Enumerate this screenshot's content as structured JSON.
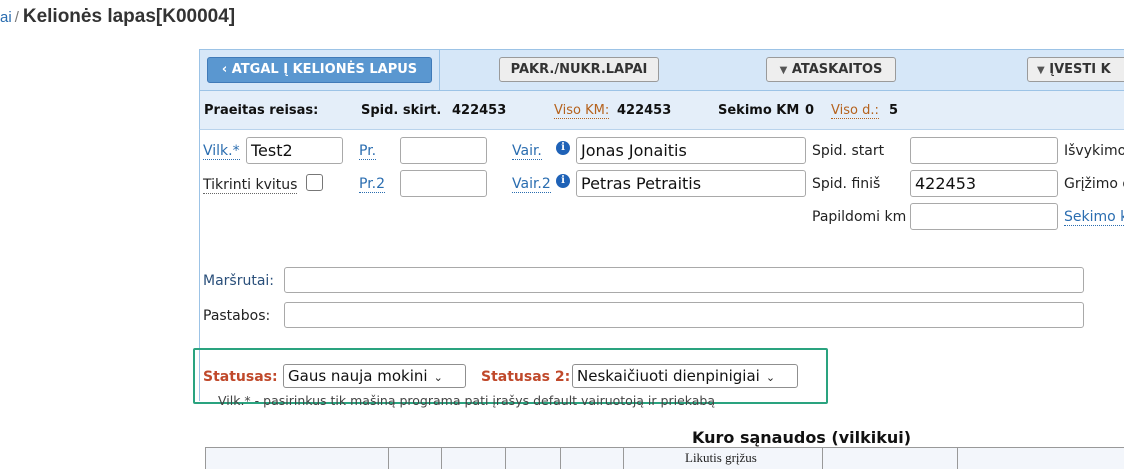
{
  "breadcrumb": {
    "prev": "ai",
    "separator": "/",
    "title": "Kelionės lapas[K00004]"
  },
  "toolbar": {
    "back_label": "ATGAL Į KELIONĖS LAPUS",
    "back_glyph": "‹",
    "load_label": "PAKR./NUKR.LAPAI",
    "reports_label": "ATASKAITOS",
    "enter_label": "ĮVESTI K",
    "dropdown_glyph": "▼"
  },
  "info": {
    "prev_trip_label": "Praeitas reisas:",
    "spid_diff_label": "Spid. skirt.",
    "spid_diff_value": "422453",
    "total_km_label": "Viso KM:",
    "total_km_value": "422453",
    "tracking_km_label": "Sekimo KM",
    "tracking_km_value": "0",
    "total_days_label": "Viso d.:",
    "total_days_value": "5"
  },
  "form": {
    "truck_label": "Vilk.*",
    "truck_value": "Test2",
    "check_receipts_label": "Tikrinti kvitus",
    "trailer1_label": "Pr.",
    "trailer1_value": "",
    "trailer2_label": "Pr.2",
    "trailer2_value": "",
    "driver1_label": "Vair.",
    "driver1_value": "Jonas Jonaitis",
    "driver2_label": "Vair.2",
    "driver2_value": "Petras Petraitis",
    "info_glyph": "i",
    "spid_start_label": "Spid. start",
    "spid_start_value": "",
    "spid_finish_label": "Spid. finiš",
    "spid_finish_value": "422453",
    "extra_km_label": "Papildomi km",
    "extra_km_value": "",
    "departure_label": "Išvykimo",
    "return_label": "Grįžimo d",
    "tracking_label": "Sekimo k",
    "routes_label": "Maršrutai:",
    "routes_value": "",
    "notes_label": "Pastabos:",
    "notes_value": ""
  },
  "status": {
    "status_label": "Statusas:",
    "status_value": "Gaus nauja mokini",
    "status2_label": "Statusas 2:",
    "status2_value": "Neskaičiuoti dienpinigiai",
    "chevron_glyph": "⌄",
    "note": "Vilk.* - pasirinkus tik mašiną programa pati įrašys default vairuotoją ir priekabą"
  },
  "fuel": {
    "title": "Kuro sąnaudos (vilkikui)",
    "header_cell": "Likutis grįžus"
  },
  "colors": {
    "toolbar_bg": "#d6e7f8",
    "primary_button": "#5a97d0",
    "status_label": "#c0492b",
    "highlight_border": "#2aa37f",
    "link": "#2a6db0",
    "orange_label": "#b5621d"
  }
}
